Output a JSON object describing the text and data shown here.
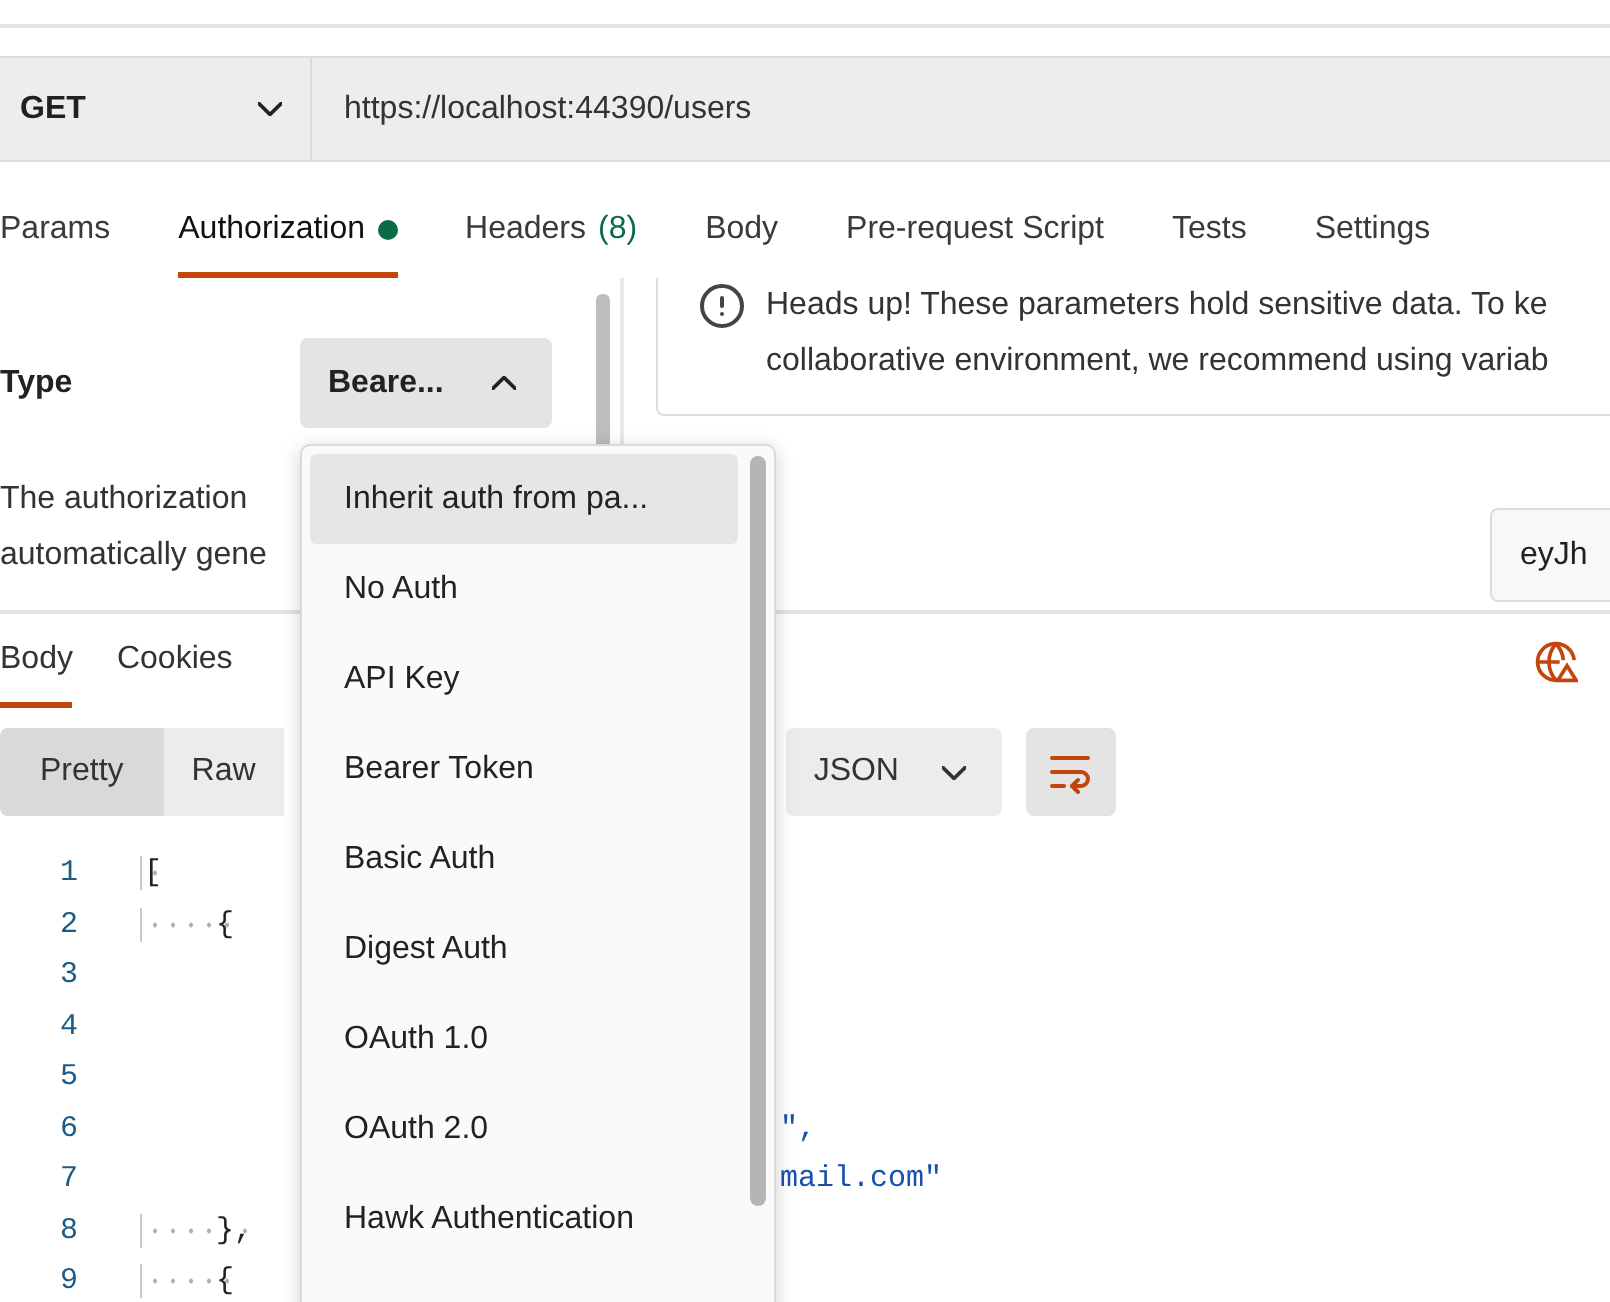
{
  "request": {
    "method": "GET",
    "url": "https://localhost:44390/users"
  },
  "request_tabs": [
    {
      "label": "Params",
      "selected": false,
      "dot": false
    },
    {
      "label": "Authorization",
      "selected": true,
      "dot": true
    },
    {
      "label": "Headers",
      "count": "(8)",
      "selected": false,
      "dot": false
    },
    {
      "label": "Body",
      "selected": false,
      "dot": false
    },
    {
      "label": "Pre-request Script",
      "selected": false,
      "dot": false
    },
    {
      "label": "Tests",
      "selected": false,
      "dot": false
    },
    {
      "label": "Settings",
      "selected": false,
      "dot": false
    }
  ],
  "auth": {
    "type_label": "Type",
    "type_value": "Beare...",
    "expanded": true,
    "description": [
      "The authorization",
      "automatically gene"
    ]
  },
  "notice": {
    "lines": [
      "Heads up! These parameters hold sensitive data. To ke",
      "collaborative environment, we recommend using variab"
    ]
  },
  "token_value": "eyJh",
  "response_tabs": [
    {
      "label": "Body",
      "selected": true
    },
    {
      "label": "Cookies",
      "selected": false
    }
  ],
  "view_modes": [
    {
      "label": "Pretty",
      "selected": true
    },
    {
      "label": "Raw",
      "selected": false
    }
  ],
  "format": "JSON",
  "code_lines": [
    {
      "number": "1",
      "text": "["
    },
    {
      "number": "2",
      "text": "    {"
    },
    {
      "number": "3"
    },
    {
      "number": "4"
    },
    {
      "number": "5"
    },
    {
      "number": "6",
      "tail": "\","
    },
    {
      "number": "7",
      "tail": "mail.com\""
    },
    {
      "number": "8",
      "text": "    },"
    },
    {
      "number": "9",
      "text": "    {"
    }
  ],
  "auth_menu": [
    {
      "label": "Inherit auth from pa...",
      "highlighted": true
    },
    {
      "label": "No Auth",
      "highlighted": false
    },
    {
      "label": "API Key",
      "highlighted": false
    },
    {
      "label": "Bearer Token",
      "highlighted": false
    },
    {
      "label": "Basic Auth",
      "highlighted": false
    },
    {
      "label": "Digest Auth",
      "highlighted": false
    },
    {
      "label": "OAuth 1.0",
      "highlighted": false
    },
    {
      "label": "OAuth 2.0",
      "highlighted": false
    },
    {
      "label": "Hawk Authentication",
      "highlighted": false
    }
  ]
}
